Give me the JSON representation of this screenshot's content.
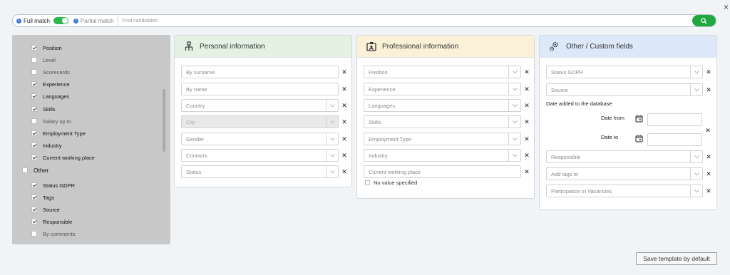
{
  "close_label": "×",
  "search": {
    "full_match_label": "Full match",
    "partial_match_label": "Partial match",
    "placeholder": "Find candidates",
    "toggle_state": "full match on"
  },
  "sidebar": {
    "items": [
      {
        "label": "Position",
        "checked": true
      },
      {
        "label": "Level",
        "checked": false
      },
      {
        "label": "Scorecards",
        "checked": false
      },
      {
        "label": "Experience",
        "checked": true
      },
      {
        "label": "Languages",
        "checked": true
      },
      {
        "label": "Skills",
        "checked": true
      },
      {
        "label": "Salary up to",
        "checked": false
      },
      {
        "label": "Employment Type",
        "checked": true
      },
      {
        "label": "Industry",
        "checked": true
      },
      {
        "label": "Current working place",
        "checked": true
      }
    ],
    "group": {
      "label": "Other",
      "checked": false
    },
    "other_items": [
      {
        "label": "Status GDPR",
        "checked": true
      },
      {
        "label": "Tags",
        "checked": true
      },
      {
        "label": "Source",
        "checked": true
      },
      {
        "label": "Responsible",
        "checked": true
      },
      {
        "label": "By comments",
        "checked": false
      }
    ]
  },
  "personal": {
    "title": "Personal information",
    "fields": [
      {
        "placeholder": "By surname",
        "dropdown": false
      },
      {
        "placeholder": "By name",
        "dropdown": false
      },
      {
        "placeholder": "Country",
        "dropdown": true
      },
      {
        "placeholder": "City",
        "dropdown": true,
        "disabled": true
      },
      {
        "placeholder": "Gender",
        "dropdown": true
      },
      {
        "placeholder": "Contacts",
        "dropdown": true
      },
      {
        "placeholder": "Status",
        "dropdown": true
      }
    ]
  },
  "professional": {
    "title": "Professional information",
    "fields": [
      {
        "placeholder": "Position",
        "dropdown": true
      },
      {
        "placeholder": "Experience",
        "dropdown": true
      },
      {
        "placeholder": "Languages",
        "dropdown": true
      },
      {
        "placeholder": "Skills",
        "dropdown": true
      },
      {
        "placeholder": "Employment Type",
        "dropdown": true
      },
      {
        "placeholder": "Industry",
        "dropdown": true
      },
      {
        "placeholder": "Current working place",
        "dropdown": false
      }
    ],
    "no_value_label": "No value specified"
  },
  "other": {
    "title": "Other / Custom fields",
    "status_gdpr": "Status GDPR",
    "source": "Source",
    "date_heading": "Date added to the database",
    "date_from": "Date from",
    "date_to": "Date to",
    "responsible": "Responsible",
    "tags": "Add tags to",
    "vacancies": "Participation in Vacancies"
  },
  "save_button": "Save template by default",
  "colors": {
    "accent_green": "#1fa83f",
    "info_blue": "#3b78d6",
    "personal_header": "#e3f2e3",
    "professional_header": "#fbf1d8",
    "other_header": "#dde8f8"
  },
  "icons": {
    "personal": "org-structure-icon",
    "professional": "id-badge-icon",
    "other": "gears-icon",
    "search": "search-icon",
    "dropdown": "chevron-down-icon",
    "clear": "close-icon",
    "calendar": "calendar-icon"
  }
}
